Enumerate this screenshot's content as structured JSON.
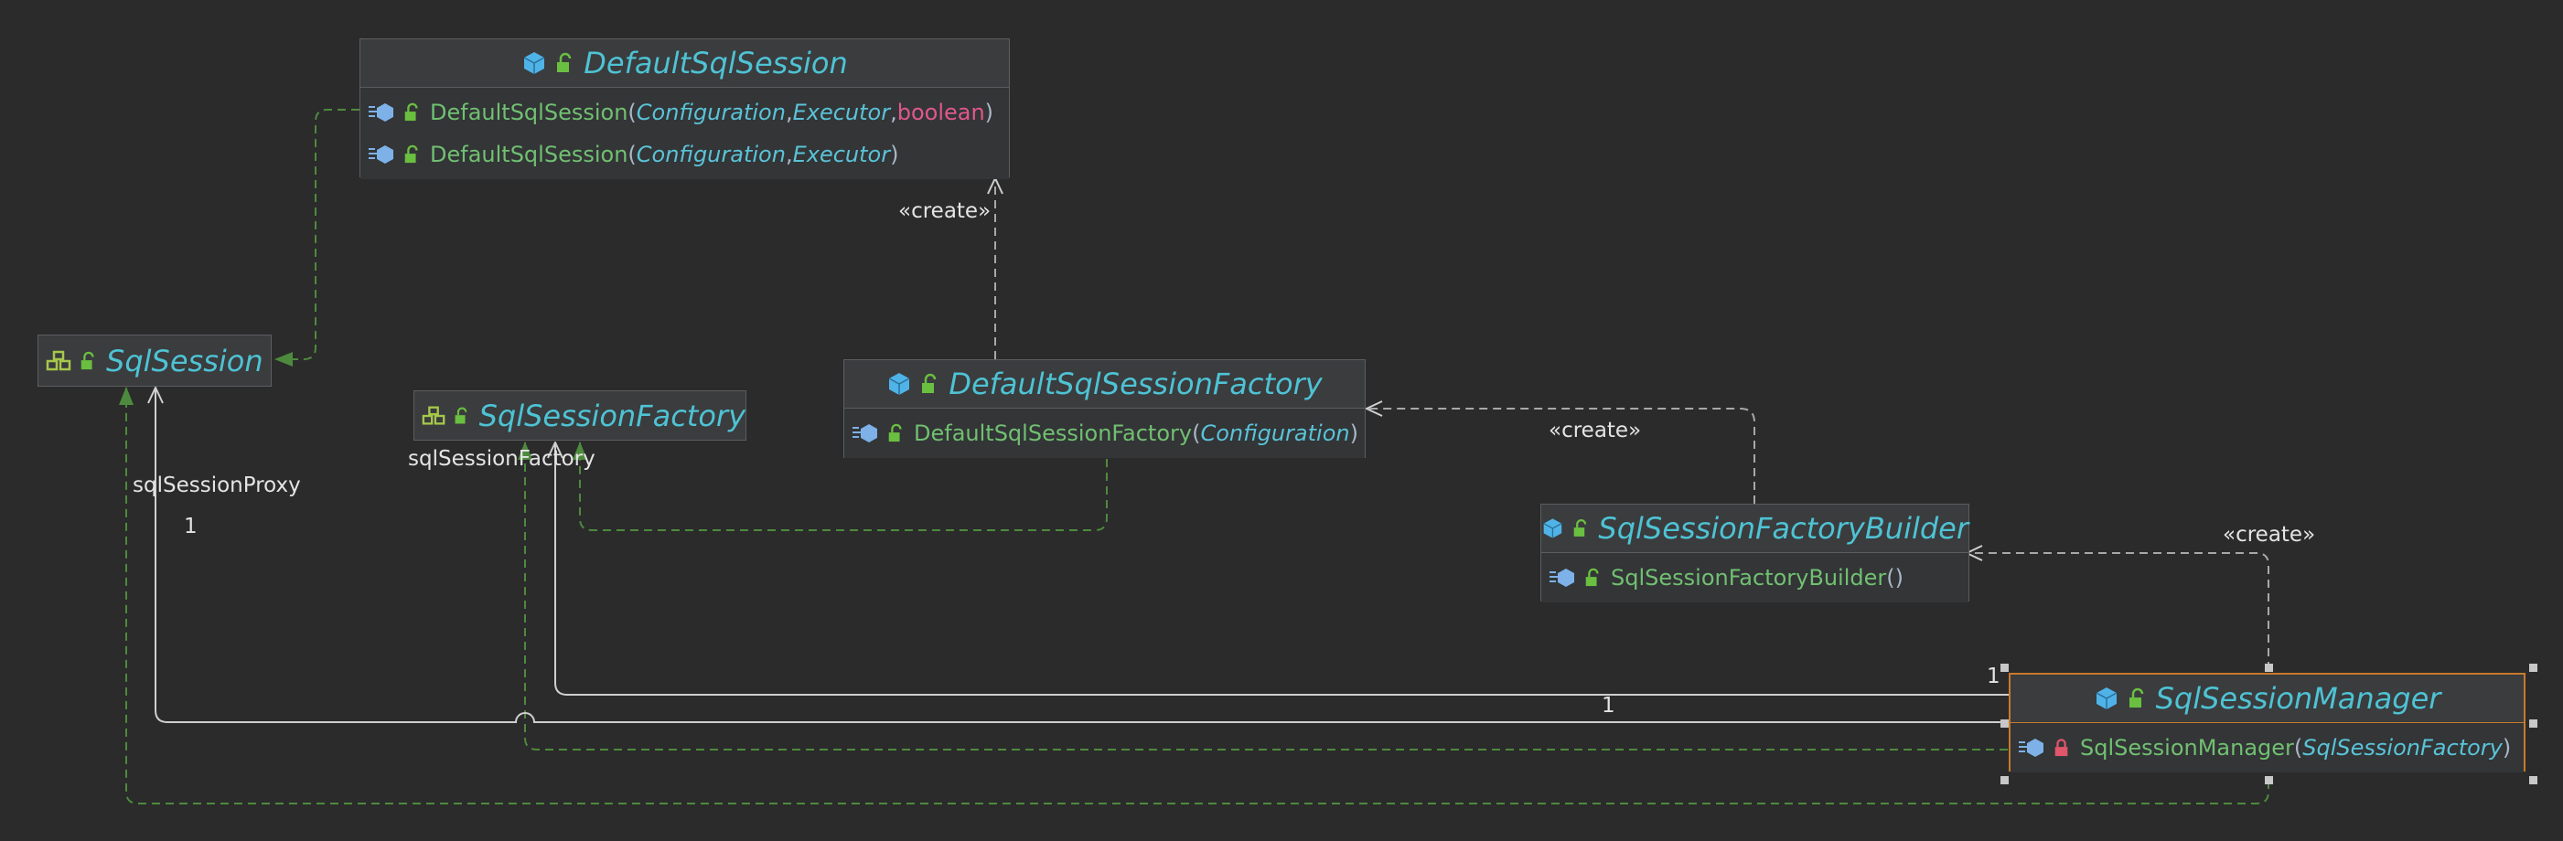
{
  "colors": {
    "background": "#2b2b2b",
    "implements": "#4e8a3e",
    "dependency": "#a8a8a8",
    "association": "#cfcfcf",
    "class_name": "#4ec3d4",
    "method_name": "#71c071",
    "param_type": "#5ac3d8",
    "keyword": "#e0588c",
    "selection": "#c87a2c"
  },
  "nodes": {
    "default_sql_session": {
      "title": "DefaultSqlSession",
      "kind_icon": "class-icon",
      "members": [
        {
          "name": "DefaultSqlSession",
          "open": "(",
          "p1": "Configuration",
          "s1": ", ",
          "p2": "Executor",
          "s2": ", ",
          "p3": "boolean",
          "close": ")"
        },
        {
          "name": "DefaultSqlSession",
          "open": "(",
          "p1": "Configuration",
          "s1": ", ",
          "p2": "Executor",
          "close": ")"
        }
      ]
    },
    "sql_session": {
      "title": "SqlSession",
      "kind_icon": "interface-icon"
    },
    "sql_session_factory": {
      "title": "SqlSessionFactory",
      "kind_icon": "interface-icon"
    },
    "default_sql_session_factory": {
      "title": "DefaultSqlSessionFactory",
      "kind_icon": "class-icon",
      "members": [
        {
          "name": "DefaultSqlSessionFactory",
          "open": "(",
          "p1": "Configuration",
          "close": ")"
        }
      ]
    },
    "sql_session_factory_builder": {
      "title": "SqlSessionFactoryBuilder",
      "kind_icon": "class-icon",
      "members": [
        {
          "name": "SqlSessionFactoryBuilder",
          "empty": " ()"
        }
      ]
    },
    "sql_session_manager": {
      "title": "SqlSessionManager",
      "kind_icon": "class-icon",
      "members": [
        {
          "name": "SqlSessionManager",
          "open": " (",
          "p1": "SqlSessionFactory",
          "close": ")",
          "private": true
        }
      ]
    }
  },
  "edge_labels": {
    "create_1": "«create»",
    "create_2": "«create»",
    "create_3": "«create»",
    "sql_session_proxy": "sqlSessionProxy",
    "sql_session_factory_role": "sqlSessionFactory",
    "mult_proxy": "1",
    "mult_factory": "1",
    "mult_center": "1"
  }
}
